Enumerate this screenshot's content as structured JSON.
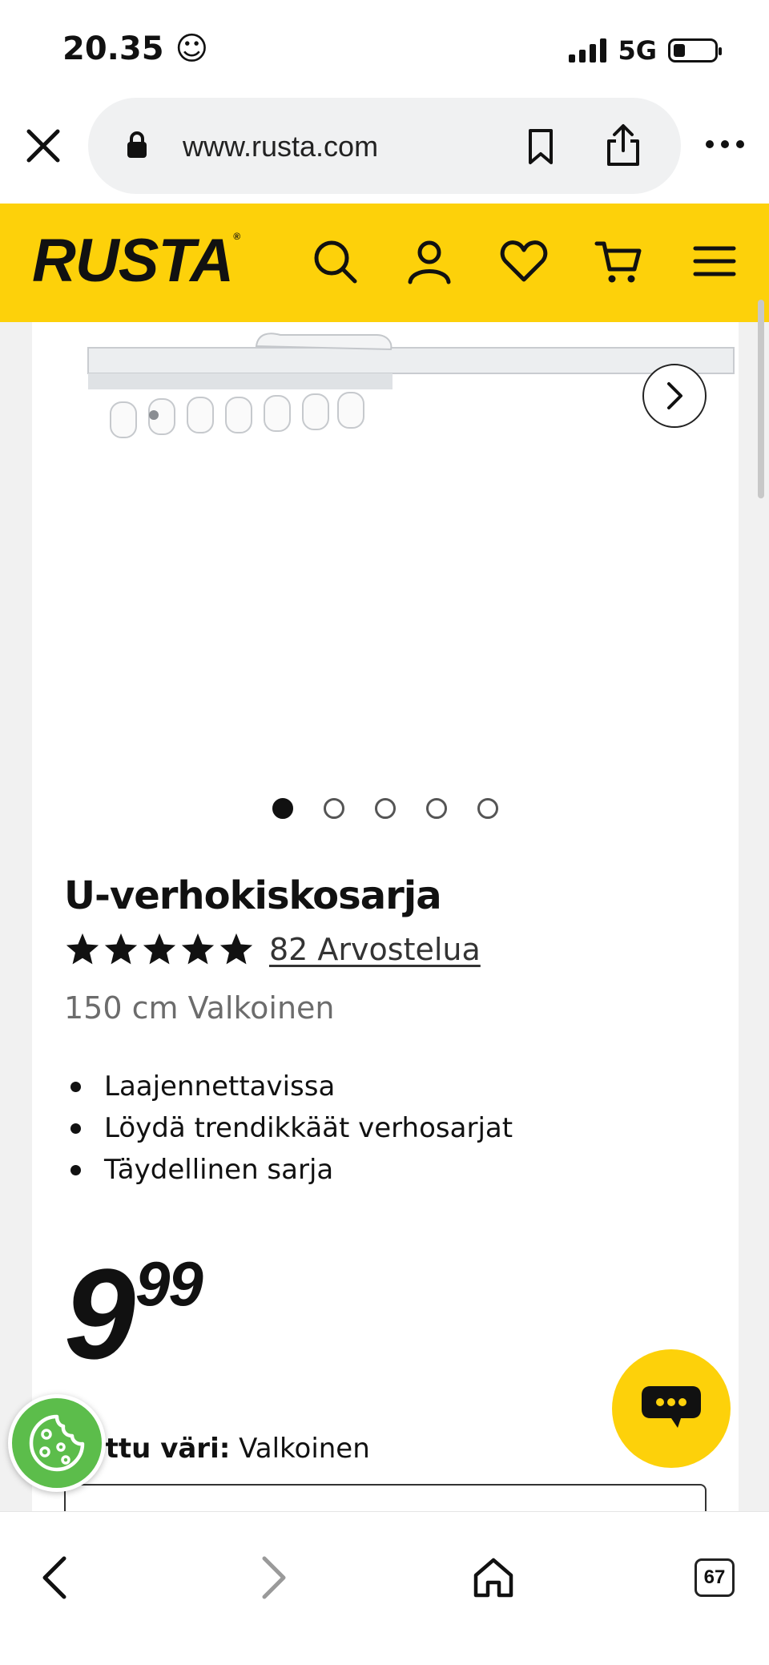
{
  "status_bar": {
    "time": "20.35 ☺",
    "network": "5G"
  },
  "browser": {
    "url": "www.rusta.com",
    "tabs_count": "67"
  },
  "site": {
    "logo": "RUSTA",
    "logo_mark": "®"
  },
  "gallery": {
    "image_count": 5,
    "active_index": 0
  },
  "product": {
    "title": "U-verhokiskosarja",
    "rating_stars": 5,
    "reviews_text": "82 Arvostelua",
    "variant": "150 cm Valkoinen",
    "features": [
      "Laajennettavissa",
      "Löydä trendikkäät verhosarjat",
      "Täydellinen sarja"
    ],
    "price_int": "9",
    "price_dec": "99",
    "color_label": "ittu väri:",
    "color_value": " Valkoinen"
  },
  "icons": {
    "close": "close-icon",
    "lock": "lock-icon",
    "bookmark": "bookmark-icon",
    "share": "share-icon",
    "more": "more-icon",
    "search": "search-icon",
    "account": "user-icon",
    "wishlist": "heart-icon",
    "cart": "cart-icon",
    "menu": "menu-icon",
    "next": "chevron-right-icon",
    "chat": "chat-icon",
    "cookie": "cookie-icon",
    "back": "back-icon",
    "forward": "forward-icon",
    "home": "home-icon"
  },
  "colors": {
    "brand_yellow": "#fdd10a",
    "cookie_green": "#5cbd4b",
    "text": "#111111",
    "muted": "#6c6c6c"
  }
}
